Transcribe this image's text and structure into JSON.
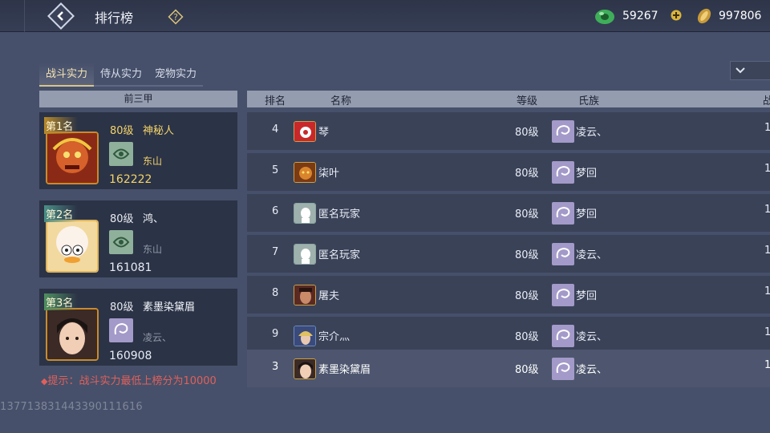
{
  "header": {
    "title": "排行榜",
    "currency1": {
      "icon": "jade-icon",
      "value": "59267"
    },
    "currency2": {
      "icon": "gold-ingot-icon",
      "value": "997806"
    }
  },
  "tabs": [
    {
      "label": "战斗实力",
      "active": true
    },
    {
      "label": "侍从实力",
      "active": false
    },
    {
      "label": "宠物实力",
      "active": false
    }
  ],
  "top3": {
    "header": "前三甲",
    "cards": [
      {
        "rank": "第1名",
        "level": "80级",
        "name": "神秘人",
        "clan": "东山",
        "power": "162222"
      },
      {
        "rank": "第2名",
        "level": "80级",
        "name": "鸿、",
        "clan": "东山",
        "power": "161081"
      },
      {
        "rank": "第3名",
        "level": "80级",
        "name": "素墨染黛眉",
        "clan": "凌云、",
        "power": "160908"
      }
    ]
  },
  "tip": "提示：战斗实力最低上榜分为10000",
  "watermark": "1377138314433901116​16",
  "table": {
    "headers": {
      "rank": "排名",
      "name": "名称",
      "level": "等级",
      "clan": "氏族",
      "power": "战"
    },
    "rows": [
      {
        "rank": "4",
        "name": "琴",
        "level": "80级",
        "clan": "凌云、",
        "power": "1",
        "self": false
      },
      {
        "rank": "5",
        "name": "柒叶",
        "level": "80级",
        "clan": "梦回",
        "power": "1",
        "self": false
      },
      {
        "rank": "6",
        "name": "匿名玩家",
        "level": "80级",
        "clan": "梦回",
        "power": "1",
        "self": false
      },
      {
        "rank": "7",
        "name": "匿名玩家",
        "level": "80级",
        "clan": "凌云、",
        "power": "1",
        "self": false
      },
      {
        "rank": "8",
        "name": "屠夫",
        "level": "80级",
        "clan": "梦回",
        "power": "1",
        "self": false
      },
      {
        "rank": "9",
        "name": "宗介灬",
        "level": "80级",
        "clan": "凌云、",
        "power": "1",
        "self": false
      },
      {
        "rank": "3",
        "name": "素墨染黛眉",
        "level": "80级",
        "clan": "凌云、",
        "power": "1",
        "self": true
      }
    ]
  },
  "colors": {
    "accent_gold": "#f3d36a",
    "tip_red": "#e0605b"
  }
}
